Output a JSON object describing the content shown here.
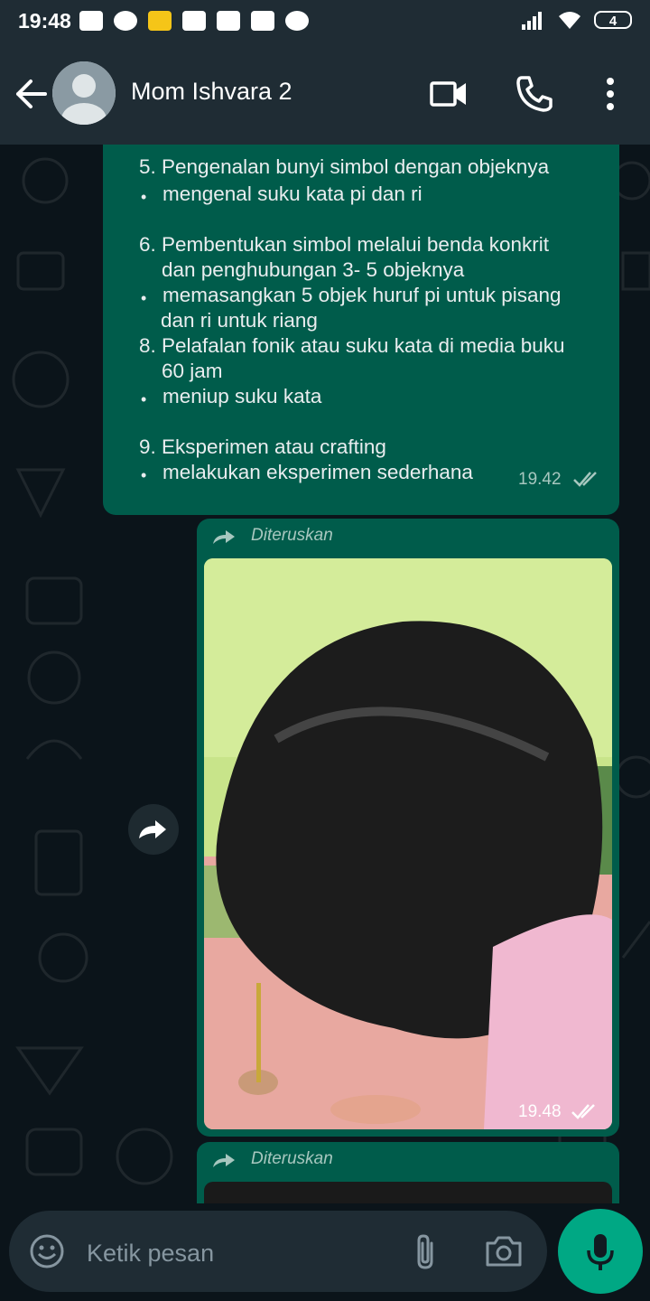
{
  "status_bar": {
    "time": "19:48",
    "battery": "4",
    "icons": [
      "message-icon",
      "notification-icon",
      "battery-saver-icon",
      "youtube-icon",
      "youtube-icon",
      "download-icon",
      "whatsapp-icon",
      "signal-icon",
      "wifi-icon",
      "battery-icon"
    ]
  },
  "header": {
    "contact_name": "Mom Ishvara 2"
  },
  "messages": {
    "text_message": {
      "item5": "5. Pengenalan bunyi simbol dengan objeknya",
      "item5_sub": "mengenal suku kata pi dan ri",
      "item6_a": "6. Pembentukan simbol melalui benda konkrit",
      "item6_b": "dan penghubungan 3- 5 objeknya",
      "item6_sub_a": "memasangkan 5 objek huruf pi untuk pisang",
      "item6_sub_b": "dan ri untuk riang",
      "item8_a": "8. Pelafalan fonik atau suku kata di media buku",
      "item8_b": "60 jam",
      "item8_sub": "meniup suku kata",
      "item9": "9. Eksperimen atau crafting",
      "item9_sub": "melakukan eksperimen sederhana",
      "bullet": "•",
      "time": "19.42"
    },
    "media_message": {
      "forwarded_label": "Diteruskan",
      "time": "19.48"
    },
    "media_message_2": {
      "forwarded_label": "Diteruskan"
    }
  },
  "input": {
    "placeholder": "Ketik pesan"
  },
  "colors": {
    "outgoing_bubble": "#005c4b",
    "header": "#1f2c34",
    "background": "#0b141a",
    "accent": "#00a884"
  }
}
